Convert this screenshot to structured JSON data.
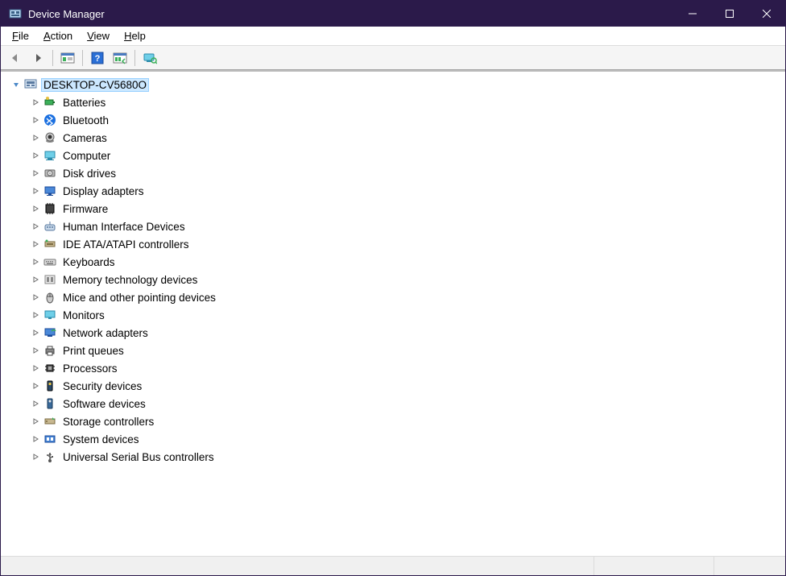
{
  "window": {
    "title": "Device Manager"
  },
  "menu": {
    "file": "File",
    "action": "Action",
    "view": "View",
    "help": "Help"
  },
  "toolbar": {
    "back": "back",
    "forward": "forward",
    "show_hide": "show-hide-console-tree",
    "help": "help",
    "props": "properties",
    "monitor": "scan-hardware"
  },
  "root": {
    "label": "DESKTOP-CV5680O",
    "expanded": true,
    "selected": true
  },
  "categories": [
    {
      "label": "Batteries",
      "icon": "battery"
    },
    {
      "label": "Bluetooth",
      "icon": "bluetooth"
    },
    {
      "label": "Cameras",
      "icon": "camera"
    },
    {
      "label": "Computer",
      "icon": "computer"
    },
    {
      "label": "Disk drives",
      "icon": "disk"
    },
    {
      "label": "Display adapters",
      "icon": "display"
    },
    {
      "label": "Firmware",
      "icon": "firmware"
    },
    {
      "label": "Human Interface Devices",
      "icon": "hid"
    },
    {
      "label": "IDE ATA/ATAPI controllers",
      "icon": "ide"
    },
    {
      "label": "Keyboards",
      "icon": "keyboard"
    },
    {
      "label": "Memory technology devices",
      "icon": "memory"
    },
    {
      "label": "Mice and other pointing devices",
      "icon": "mouse"
    },
    {
      "label": "Monitors",
      "icon": "monitor"
    },
    {
      "label": "Network adapters",
      "icon": "network"
    },
    {
      "label": "Print queues",
      "icon": "printer"
    },
    {
      "label": "Processors",
      "icon": "cpu"
    },
    {
      "label": "Security devices",
      "icon": "security"
    },
    {
      "label": "Software devices",
      "icon": "software"
    },
    {
      "label": "Storage controllers",
      "icon": "storage"
    },
    {
      "label": "System devices",
      "icon": "system"
    },
    {
      "label": "Universal Serial Bus controllers",
      "icon": "usb"
    }
  ]
}
